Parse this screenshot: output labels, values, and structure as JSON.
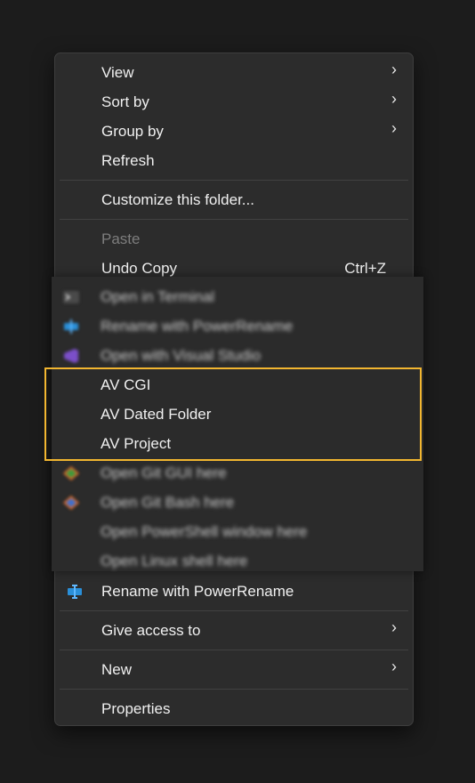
{
  "menu": {
    "view": "View",
    "sort_by": "Sort by",
    "group_by": "Group by",
    "refresh": "Refresh",
    "customize": "Customize this folder...",
    "paste": "Paste",
    "undo_copy": "Undo Copy",
    "undo_shortcut": "Ctrl+Z",
    "rename_powerrename": "Rename with PowerRename",
    "give_access": "Give access to",
    "new": "New",
    "properties": "Properties",
    "submenu_arrow": "›"
  },
  "third_party": {
    "open_terminal": "Open in Terminal",
    "rename_powerrename": "Rename with PowerRename",
    "open_vs": "Open with Visual Studio",
    "av_cgi": "AV CGI",
    "av_dated_folder": "AV Dated Folder",
    "av_project": "AV Project",
    "git_gui": "Open Git GUI here",
    "git_bash": "Open Git Bash here",
    "powershell": "Open PowerShell window here",
    "linux_shell": "Open Linux shell here"
  },
  "colors": {
    "highlight": "#f2b630",
    "menu_bg": "#2c2c2c"
  },
  "icons": [
    "terminal-icon",
    "powerrename-icon",
    "visual-studio-icon",
    "git-icon",
    "git-bash-icon"
  ]
}
